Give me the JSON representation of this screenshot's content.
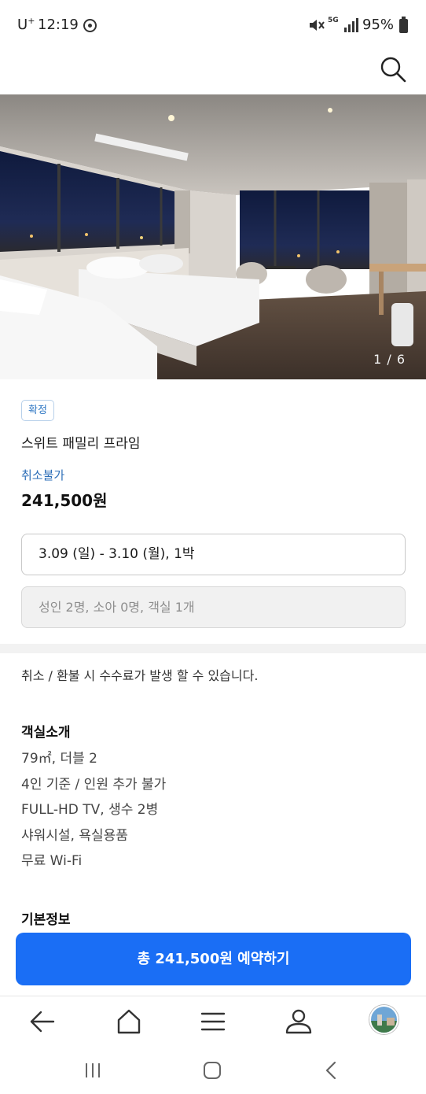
{
  "status_bar": {
    "carrier": "U",
    "carrier_sup": "+",
    "time": "12:19",
    "network": "5G",
    "battery": "95%"
  },
  "header": {
    "search_icon": "search-icon"
  },
  "hero": {
    "counter": "1 / 6",
    "description_colors": {
      "sky": "#1a2547",
      "wall": "#cfcac4",
      "floor": "#5a4a3f",
      "bed": "#f4f4f4"
    }
  },
  "room": {
    "badge": "확정",
    "name": "스위트 패밀리 프라임",
    "refund_policy": "취소불가",
    "price": "241,500원",
    "date_range": "3.09 (일) - 3.10 (월), 1박",
    "guests": "성인 2명, 소아 0명, 객실 1개"
  },
  "notice": "취소 / 환불 시 수수료가 발생 할 수 있습니다.",
  "room_intro": {
    "title": "객실소개",
    "items": [
      "79㎡, 더블 2",
      "4인 기준 / 인원 추가 불가",
      "FULL-HD TV, 생수 2병",
      "샤워시설, 욕실용품",
      "무료 Wi-Fi"
    ]
  },
  "basic_info": {
    "title": "기본정보"
  },
  "cta": {
    "label": "총 241,500원 예약하기",
    "color": "#1a6ef5"
  },
  "bottom_nav": {
    "icons": [
      "back-arrow-icon",
      "home-icon",
      "menu-icon",
      "profile-icon",
      "avatar"
    ]
  },
  "system_nav": {
    "icons": [
      "recent-apps-icon",
      "home-icon",
      "back-icon"
    ]
  }
}
